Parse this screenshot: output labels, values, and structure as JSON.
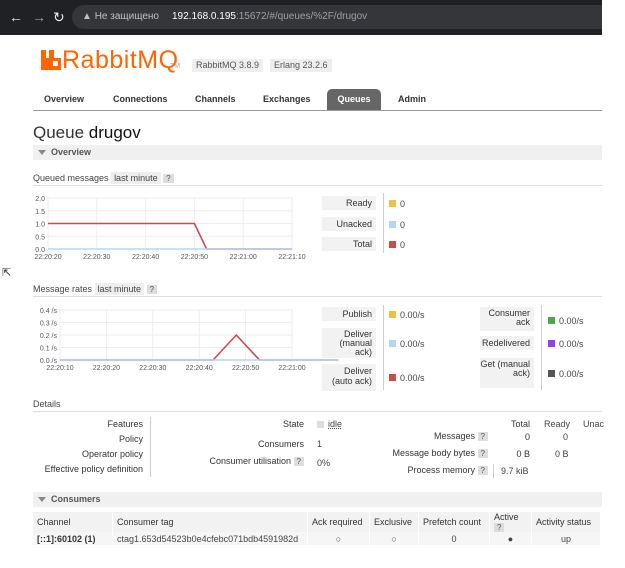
{
  "browser": {
    "security_warning": "Не защищено",
    "url_host": "192.168.0.195",
    "url_path": ":15672/#/queues/%2F/drugov"
  },
  "header": {
    "logo_text": "RabbitMQ",
    "tm": "TM",
    "rabbitmq_version": "RabbitMQ 3.8.9",
    "erlang_version": "Erlang 23.2.6"
  },
  "tabs": [
    "Overview",
    "Connections",
    "Channels",
    "Exchanges",
    "Queues",
    "Admin"
  ],
  "active_tab": "Queues",
  "page": {
    "title_prefix": "Queue",
    "queue_name": "drugov"
  },
  "overview_section": {
    "title": "Overview"
  },
  "queued_messages": {
    "label": "Queued messages",
    "range": "last minute",
    "help": "?",
    "legend": [
      {
        "label": "Ready",
        "value": "0",
        "color": "#edc240"
      },
      {
        "label": "Unacked",
        "value": "0",
        "color": "#afd8f8"
      },
      {
        "label": "Total",
        "value": "0",
        "color": "#cb4b4b"
      }
    ]
  },
  "message_rates": {
    "label": "Message rates",
    "range": "last minute",
    "help": "?",
    "legend_left": [
      {
        "label": "Publish",
        "value": "0.00/s",
        "color": "#edc240"
      },
      {
        "label": "Deliver (manual ack)",
        "value": "0.00/s",
        "color": "#afd8f8"
      },
      {
        "label": "Deliver (auto ack)",
        "value": "0.00/s",
        "color": "#cb4b4b"
      }
    ],
    "legend_right": [
      {
        "label": "Consumer ack",
        "value": "0.00/s",
        "color": "#4da74d"
      },
      {
        "label": "Redelivered",
        "value": "0.00/s",
        "color": "#9440ed"
      },
      {
        "label": "Get (manual ack)",
        "value": "0.00/s",
        "color": "#555555"
      }
    ]
  },
  "chart_data": [
    {
      "type": "line",
      "ylim": [
        0,
        2.0
      ],
      "yticks": [
        "2.0",
        "1.5",
        "1.0",
        "0.5",
        "0.0"
      ],
      "xticks": [
        "22:20:20",
        "22:20:30",
        "22:20:40",
        "22:20:50",
        "22:21:00",
        "22:21:10"
      ],
      "series": [
        {
          "name": "Total",
          "color": "#cb4b4b",
          "x": [
            "22:20:20",
            "22:20:50",
            "22:20:52.5",
            "22:21:10"
          ],
          "values": [
            1,
            1,
            0,
            0
          ]
        },
        {
          "name": "Unacked",
          "color": "#afd8f8",
          "x": [
            "22:20:20",
            "22:21:10"
          ],
          "values": [
            0,
            0
          ]
        }
      ]
    },
    {
      "type": "line",
      "ylim": [
        0,
        0.4
      ],
      "yticks": [
        "0.4 /s",
        "0.3 /s",
        "0.2 /s",
        "0.1 /s",
        "0.0 /s"
      ],
      "xticks": [
        "22:20:10",
        "22:20:20",
        "22:20:30",
        "22:20:40",
        "22:20:50",
        "22:21:00"
      ],
      "series": [
        {
          "name": "Deliver (auto ack)",
          "color": "#cb4b4b",
          "x": [
            "22:20:10",
            "22:20:43",
            "22:20:48",
            "22:20:53",
            "22:21:10"
          ],
          "values": [
            0,
            0,
            0.2,
            0,
            0
          ]
        },
        {
          "name": "Deliver (manual ack)",
          "color": "#afd8f8",
          "x": [
            "22:20:10",
            "22:21:10"
          ],
          "values": [
            0,
            0
          ]
        }
      ]
    }
  ],
  "details": {
    "title": "Details",
    "left_keys": [
      "Features",
      "Policy",
      "Operator policy",
      "Effective policy definition"
    ],
    "state_label": "State",
    "state_value": "idle",
    "consumers_label": "Consumers",
    "consumers_value": "1",
    "utilisation_label": "Consumer utilisation",
    "utilisation_help": "?",
    "utilisation_value": "0%",
    "stats_headers": [
      "Total",
      "Ready",
      "Unac"
    ],
    "messages_label": "Messages",
    "messages_help": "?",
    "messages_values": [
      "0",
      "0"
    ],
    "bytes_label": "Message body bytes",
    "bytes_help": "?",
    "bytes_values": [
      "0 B",
      "0 B"
    ],
    "process_label": "Process memory",
    "process_help": "?",
    "process_value": "9.7 kiB"
  },
  "consumers_section": {
    "title": "Consumers",
    "headers": [
      "Channel",
      "Consumer tag",
      "Ack required",
      "Exclusive",
      "Prefetch count",
      "Active",
      "Activity status"
    ],
    "active_help": "?",
    "row": {
      "channel": "[::1]:60102 (1)",
      "tag": "ctag1.653d54523b0e4cfebc071bdb4591982d",
      "ack_required": "○",
      "exclusive": "○",
      "prefetch": "0",
      "active": "●",
      "status": "up"
    }
  }
}
